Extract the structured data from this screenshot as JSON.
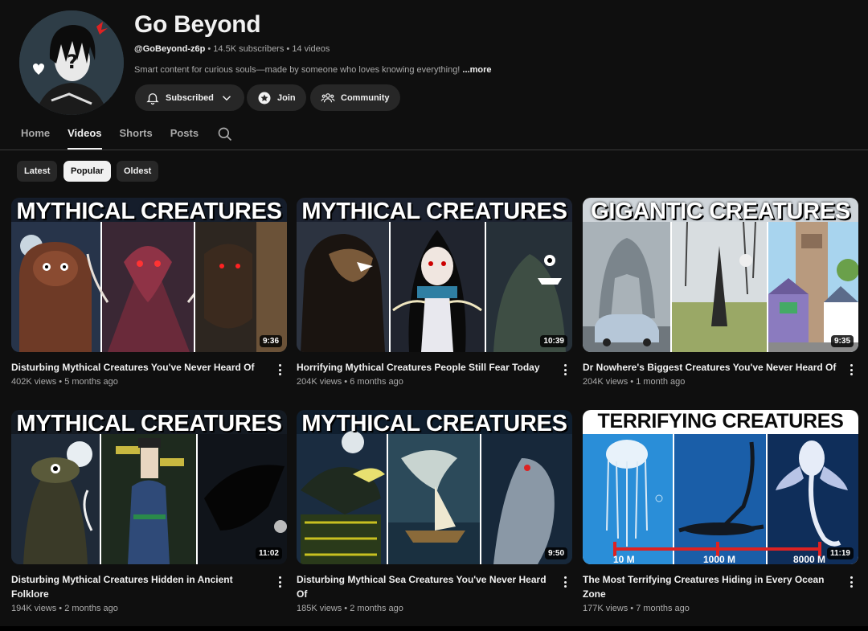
{
  "channel": {
    "name": "Go Beyond",
    "handle": "@GoBeyond-z6p",
    "stats": " • 14.5K subscribers • 14 videos",
    "description": "Smart content for curious souls—made by someone who loves knowing everything!",
    "more_label": " ...more"
  },
  "actions": {
    "subscribed_label": "Subscribed",
    "join_label": "Join",
    "community_label": "Community"
  },
  "tabs": [
    {
      "label": "Home"
    },
    {
      "label": "Videos",
      "active": true
    },
    {
      "label": "Shorts"
    },
    {
      "label": "Posts"
    }
  ],
  "chips": [
    {
      "label": "Latest"
    },
    {
      "label": "Popular",
      "selected": true
    },
    {
      "label": "Oldest"
    }
  ],
  "videos": [
    {
      "thumb_title": "MYTHICAL CREATURES",
      "duration": "9:36",
      "title": "Disturbing Mythical Creatures You've Never Heard Of",
      "meta": "402K views • 5 months ago"
    },
    {
      "thumb_title": "MYTHICAL CREATURES",
      "duration": "10:39",
      "title": "Horrifying Mythical Creatures People Still Fear Today",
      "meta": "204K views • 6 months ago"
    },
    {
      "thumb_title": "GIGANTIC CREATURES",
      "duration": "9:35",
      "title": "Dr Nowhere's Biggest Creatures You've Never Heard Of",
      "meta": "204K views • 1 month ago"
    },
    {
      "thumb_title": "MYTHICAL CREATURES",
      "duration": "11:02",
      "title": "Disturbing Mythical Creatures Hidden in Ancient Folklore",
      "meta": "194K views • 2 months ago"
    },
    {
      "thumb_title": "MYTHICAL CREATURES",
      "duration": "9:50",
      "title": "Disturbing Mythical Sea Creatures You've Never Heard Of",
      "meta": "185K views • 2 months ago"
    },
    {
      "thumb_title": "TERRIFYING   CREATURES",
      "duration": "11:19",
      "title": "The Most Terrifying Creatures Hiding in Every Ocean Zone",
      "meta": "177K views • 7 months ago",
      "scale_labels": [
        "10 M",
        "1000 M",
        "8000 M"
      ]
    }
  ],
  "colors": {
    "background": "#0f0f0f",
    "pill": "#272727",
    "text_primary": "#f1f1f1",
    "text_secondary": "#aaaaaa"
  }
}
